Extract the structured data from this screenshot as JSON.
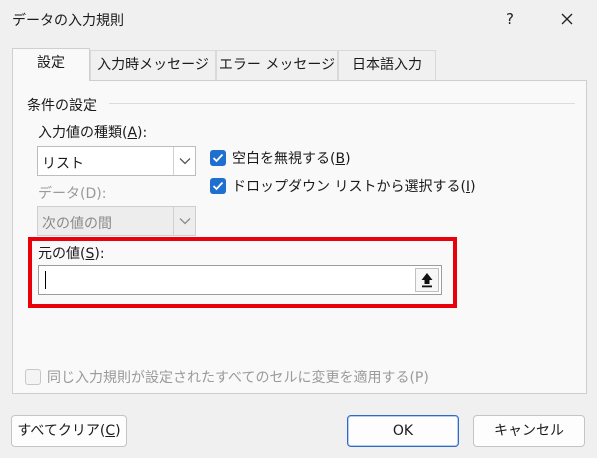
{
  "window": {
    "title": "データの入力規則",
    "help_label": "?"
  },
  "tabs": [
    {
      "label": "設定",
      "active": true
    },
    {
      "label": "入力時メッセージ",
      "active": false
    },
    {
      "label": "エラー メッセージ",
      "active": false
    },
    {
      "label": "日本語入力",
      "active": false
    }
  ],
  "conditions": {
    "group_title": "条件の設定",
    "allow": {
      "label_prefix": "入力値の種類(",
      "label_key": "A",
      "label_suffix": "):",
      "value": "リスト"
    },
    "data": {
      "label": "データ(D):",
      "value": "次の値の間",
      "enabled": false
    },
    "ignore_blank": {
      "label_prefix": "空白を無視する(",
      "label_key": "B",
      "label_suffix": ")",
      "checked": true
    },
    "in_cell_dropdown": {
      "label_prefix": "ドロップダウン リストから選択する(",
      "label_key": "I",
      "label_suffix": ")",
      "checked": true
    },
    "source": {
      "label_prefix": "元の値(",
      "label_key": "S",
      "label_suffix": "):",
      "value": ""
    },
    "apply_all": {
      "label": "同じ入力規則が設定されたすべてのセルに変更を適用する(P)",
      "checked": false,
      "enabled": false
    }
  },
  "buttons": {
    "clear_all_prefix": "すべてクリア(",
    "clear_all_key": "C",
    "clear_all_suffix": ")",
    "ok": "OK",
    "cancel": "キャンセル"
  },
  "colors": {
    "highlight": "#e8000b",
    "checkbox": "#1f6fd0",
    "ok_border": "#2f6bc6"
  }
}
